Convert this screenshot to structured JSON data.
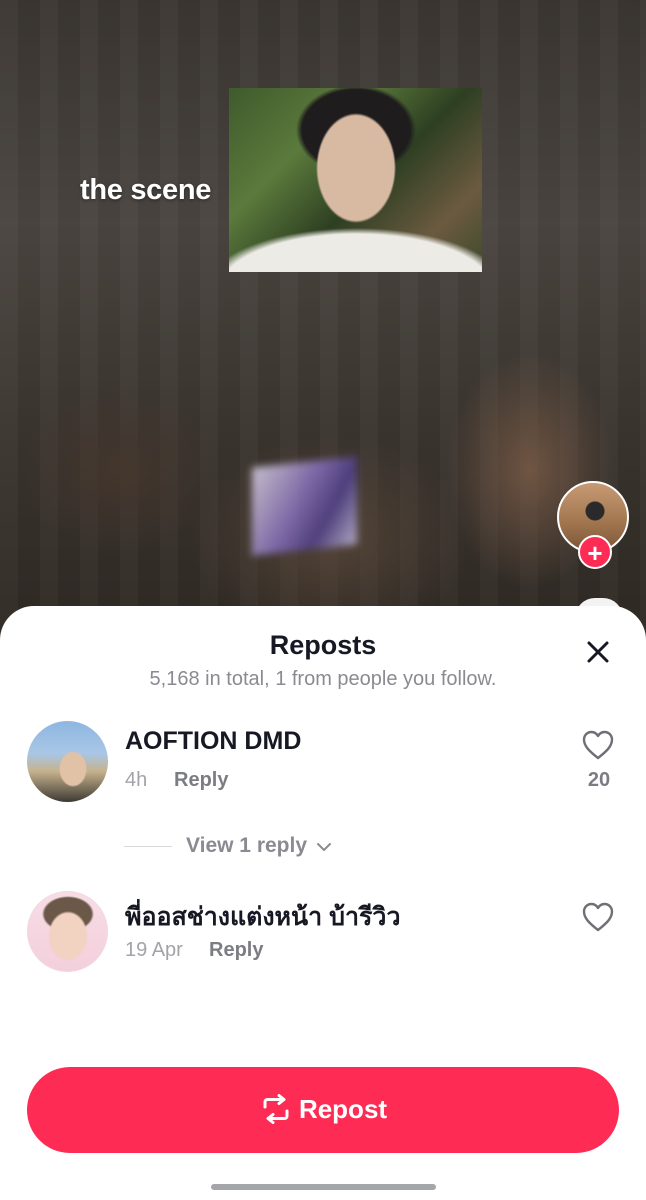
{
  "video": {
    "overlay_text": "the scene"
  },
  "sheet": {
    "title": "Reposts",
    "subtitle": "5,168 in total, 1 from people you follow.",
    "close_icon": "close-icon"
  },
  "comments": [
    {
      "name": "AOFTION DMD",
      "time": "4h",
      "reply_label": "Reply",
      "likes": "20"
    },
    {
      "name": "พี่ออสช่างแต่งหน้า บ้ารีวิว",
      "time": "19 Apr",
      "reply_label": "Reply",
      "likes": ""
    }
  ],
  "view_replies": {
    "label": "View 1 reply"
  },
  "repost_button": {
    "label": "Repost",
    "icon": "repost-icon"
  },
  "colors": {
    "accent": "#fe2c55",
    "text_primary": "#161823",
    "text_secondary": "#8a8b91"
  }
}
